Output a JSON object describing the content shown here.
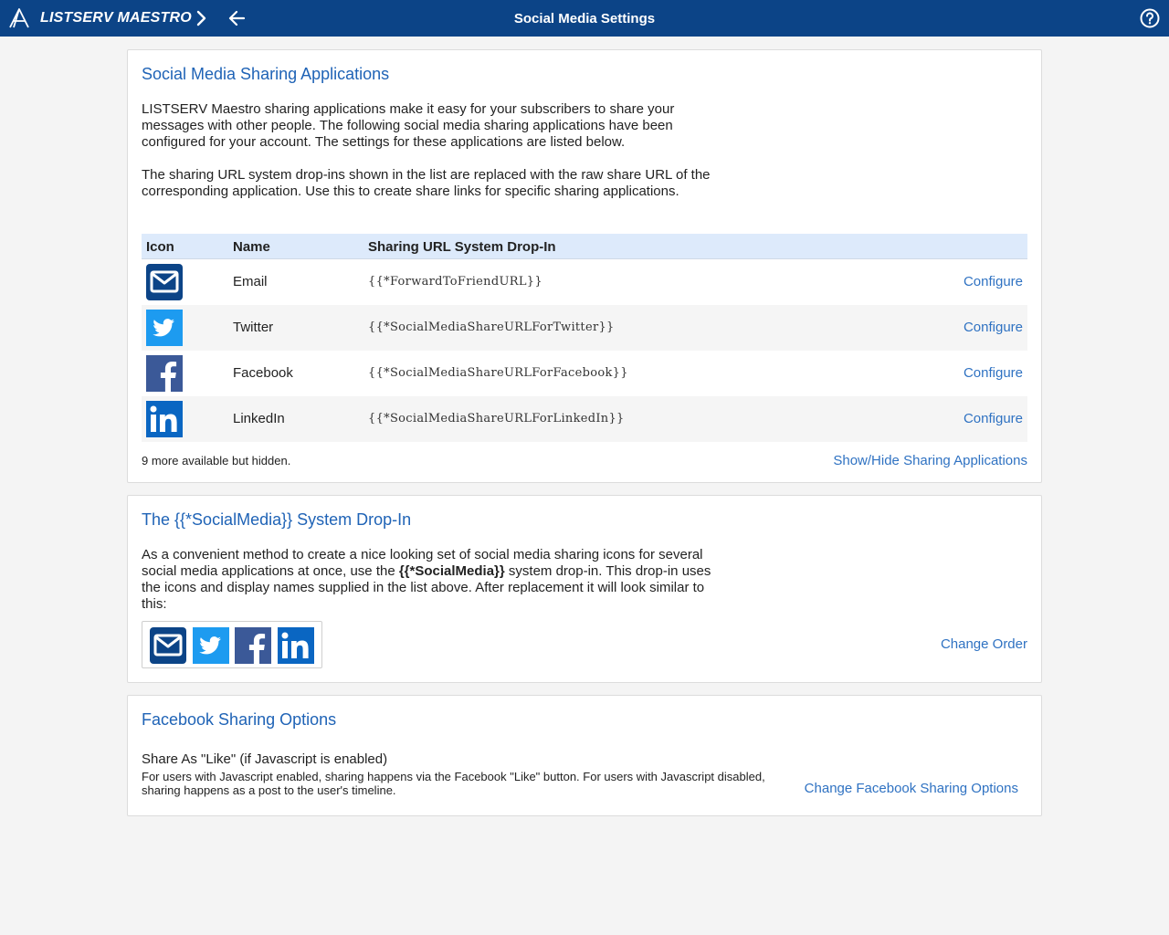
{
  "topbar": {
    "app_name": "LISTSERV MAESTRO",
    "page_title": "Social Media Settings"
  },
  "sharing_panel": {
    "title": "Social Media Sharing Applications",
    "para1": "LISTSERV Maestro sharing applications make it easy for your subscribers to share your messages with other people. The following social media sharing applications have been configured for your account. The settings for these applications are listed below.",
    "para2": "The sharing URL system drop-ins shown in the list are replaced with the raw share URL of the corresponding application. Use this to create share links for specific sharing applications.",
    "columns": {
      "icon": "Icon",
      "name": "Name",
      "dropin": "Sharing URL System Drop-In"
    },
    "rows": [
      {
        "icon": "email-icon",
        "name": "Email",
        "dropin": "{{*ForwardToFriendURL}}",
        "action": "Configure"
      },
      {
        "icon": "twitter-icon",
        "name": "Twitter",
        "dropin": "{{*SocialMediaShareURLForTwitter}}",
        "action": "Configure"
      },
      {
        "icon": "facebook-icon",
        "name": "Facebook",
        "dropin": "{{*SocialMediaShareURLForFacebook}}",
        "action": "Configure"
      },
      {
        "icon": "linkedin-icon",
        "name": "LinkedIn",
        "dropin": "{{*SocialMediaShareURLForLinkedIn}}",
        "action": "Configure"
      }
    ],
    "hidden_note": "9 more available but hidden.",
    "show_hide": "Show/Hide Sharing Applications"
  },
  "dropin_panel": {
    "title": "The {{*SocialMedia}} System Drop-In",
    "para_a": "As a convenient method to create a nice looking set of social media sharing icons for several social media applications at once, use the ",
    "para_bold": "{{*SocialMedia}}",
    "para_b": " system drop-in. This drop-in uses the icons and display names supplied in the list above. After replacement it will look similar to this:",
    "change_order": "Change Order"
  },
  "facebook_panel": {
    "title": "Facebook Sharing Options",
    "option_title": "Share As \"Like\" (if Javascript is enabled)",
    "option_desc": "For users with Javascript enabled, sharing happens via the Facebook \"Like\" button. For users with Javascript disabled, sharing happens as a post to the user's timeline.",
    "change": "Change Facebook Sharing Options"
  },
  "colors": {
    "topbar": "#0c4487",
    "link": "#2f72c2",
    "title": "#1f63b6",
    "email": "#0c4487",
    "twitter": "#1d9bf0",
    "facebook": "#3b5998",
    "linkedin": "#0a66c2"
  }
}
